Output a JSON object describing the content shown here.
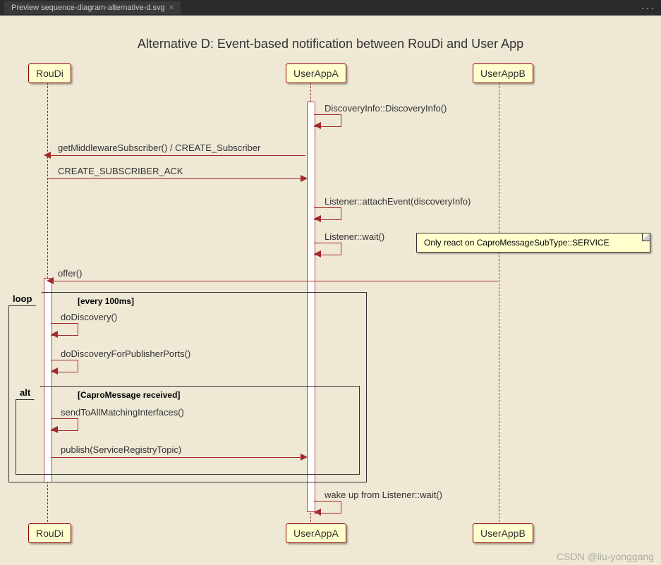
{
  "tab": {
    "title": "Preview sequence-diagram-alternative-d.svg"
  },
  "title": "Alternative D: Event-based notification between RouDi and User App",
  "participants": {
    "p1": "RouDi",
    "p2": "UserAppA",
    "p3": "UserAppB"
  },
  "messages": {
    "m1": "DiscoveryInfo::DiscoveryInfo()",
    "m2": "getMiddlewareSubscriber() / CREATE_Subscriber",
    "m3": "CREATE_SUBSCRIBER_ACK",
    "m4": "Listener::attachEvent(discoveryInfo)",
    "m5": "Listener::wait()",
    "m6": "offer()",
    "m7": "doDiscovery()",
    "m8": "doDiscoveryForPublisherPorts()",
    "m9": "sendToAllMatchingInterfaces()",
    "m10": "publish(ServiceRegistryTopic)",
    "m11": "wake up from Listener::wait()"
  },
  "frames": {
    "loop_label": "loop",
    "loop_cond": "[every 100ms]",
    "alt_label": "alt",
    "alt_cond": "[CaproMessage received]"
  },
  "note": "Only react on CaproMessageSubType::SERVICE",
  "watermark": "CSDN @liu-yonggang"
}
